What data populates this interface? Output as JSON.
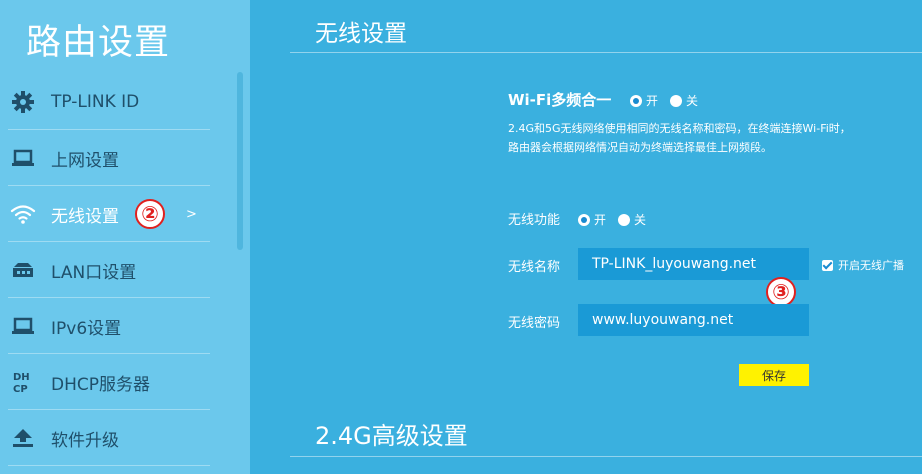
{
  "sidebar": {
    "title": "路由设置",
    "items": [
      {
        "label": "TP-LINK ID",
        "icon": "gear-icon"
      },
      {
        "label": "上网设置",
        "icon": "laptop-icon"
      },
      {
        "label": "无线设置",
        "icon": "wifi-icon",
        "active": true,
        "badge": "②",
        "arrow": ">"
      },
      {
        "label": "LAN口设置",
        "icon": "lan-icon"
      },
      {
        "label": "IPv6设置",
        "icon": "laptop-icon"
      },
      {
        "label": "DHCP服务器",
        "icon": "dhcp-icon"
      },
      {
        "label": "软件升级",
        "icon": "upload-icon"
      }
    ]
  },
  "main": {
    "title": "无线设置",
    "wifi_multi": {
      "label": "Wi-Fi多频合一",
      "on_label": "开",
      "off_label": "关",
      "value": "on",
      "description_line1": "2.4G和5G无线网络使用相同的无线名称和密码，在终端连接Wi-Fi时，",
      "description_line2": "路由器会根据网络情况自动为终端选择最佳上网频段。"
    },
    "wireless_function": {
      "label": "无线功能",
      "on_label": "开",
      "off_label": "关",
      "value": "on"
    },
    "ssid": {
      "label": "无线名称",
      "value": "TP-LINK_luyouwang.net",
      "broadcast_label": "开启无线广播",
      "broadcast_checked": true,
      "badge": "③"
    },
    "password": {
      "label": "无线密码",
      "value": "www.luyouwang.net"
    },
    "save_label": "保存",
    "section2_title": "2.4G高级设置"
  },
  "colors": {
    "main_bg": "#3ab0df",
    "sidebar_bg": "#6bc8ec",
    "field_bg": "#1a9ad6",
    "save_bg": "#fff200",
    "badge_red": "#e0211f",
    "nav_text": "#1f4f6a"
  }
}
